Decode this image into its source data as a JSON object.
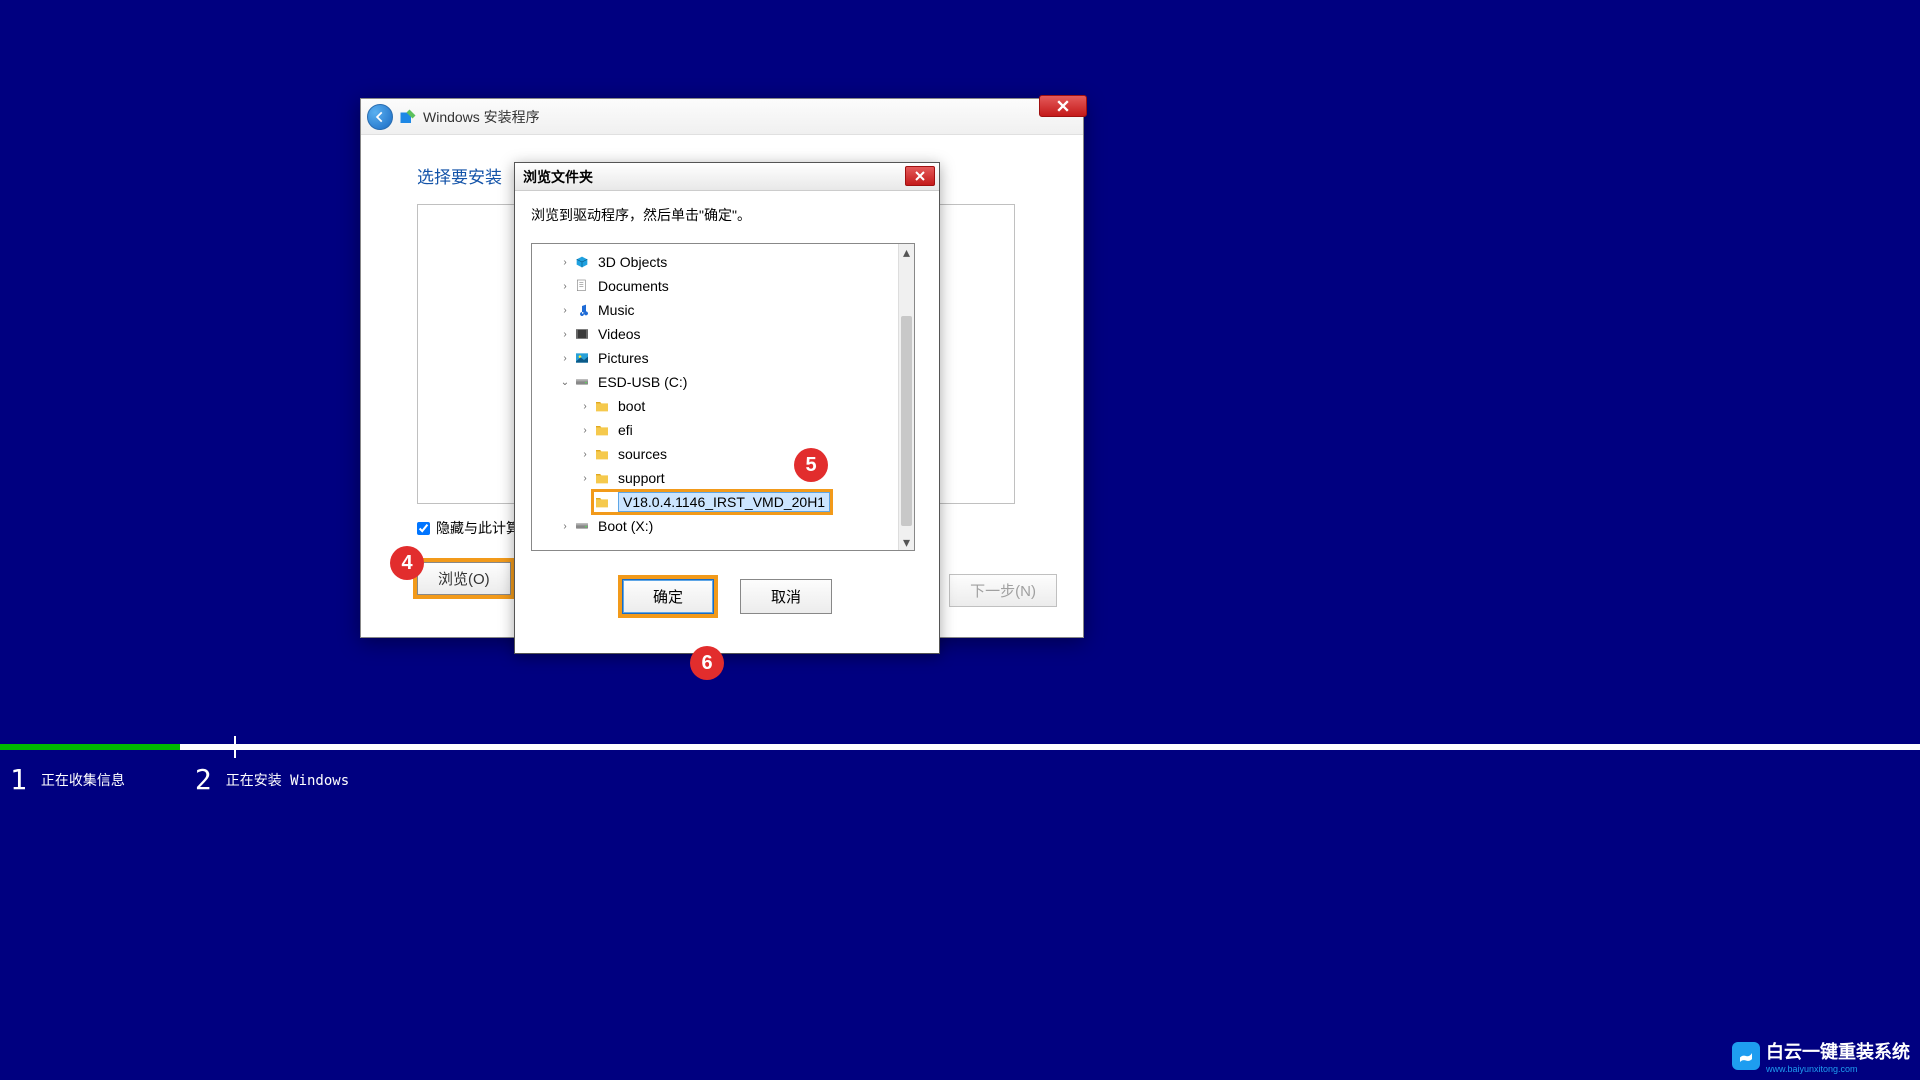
{
  "setup_window": {
    "app_title": "Windows 安装程序",
    "section_heading": "选择要安装",
    "hide_checkbox_label": "隐藏与此计算",
    "hide_checkbox_checked": true,
    "browse_button": "浏览(O)",
    "next_button": "下一步(N)"
  },
  "browse_dialog": {
    "title": "浏览文件夹",
    "instruction": "浏览到驱动程序，然后单击\"确定\"。",
    "ok_button": "确定",
    "cancel_button": "取消",
    "tree": [
      {
        "label": "3D Objects",
        "icon": "3d-objects-icon",
        "indent": 1,
        "expandable": true
      },
      {
        "label": "Documents",
        "icon": "documents-icon",
        "indent": 1,
        "expandable": true
      },
      {
        "label": "Music",
        "icon": "music-icon",
        "indent": 1,
        "expandable": true
      },
      {
        "label": "Videos",
        "icon": "videos-icon",
        "indent": 1,
        "expandable": true
      },
      {
        "label": "Pictures",
        "icon": "pictures-icon",
        "indent": 1,
        "expandable": true
      },
      {
        "label": "ESD-USB (C:)",
        "icon": "drive-icon",
        "indent": 1,
        "expandable": true,
        "expanded": true
      },
      {
        "label": "boot",
        "icon": "folder-icon",
        "indent": 2,
        "expandable": true
      },
      {
        "label": "efi",
        "icon": "folder-icon",
        "indent": 2,
        "expandable": true
      },
      {
        "label": "sources",
        "icon": "folder-icon",
        "indent": 2,
        "expandable": true
      },
      {
        "label": "support",
        "icon": "folder-icon",
        "indent": 2,
        "expandable": true
      },
      {
        "label": "V18.0.4.1146_IRST_VMD_20H1",
        "icon": "folder-icon",
        "indent": 2,
        "selected": true
      },
      {
        "label": "Boot (X:)",
        "icon": "drive-icon",
        "indent": 1,
        "expandable": true
      }
    ]
  },
  "annotations": {
    "a4": "4",
    "a5": "5",
    "a6": "6"
  },
  "progress": {
    "phase1": {
      "num": "1",
      "text": "正在收集信息"
    },
    "phase2": {
      "num": "2",
      "text": "正在安装 Windows"
    }
  },
  "watermark": {
    "main": "白云一键重装系统",
    "sub": "www.baiyunxitong.com"
  }
}
